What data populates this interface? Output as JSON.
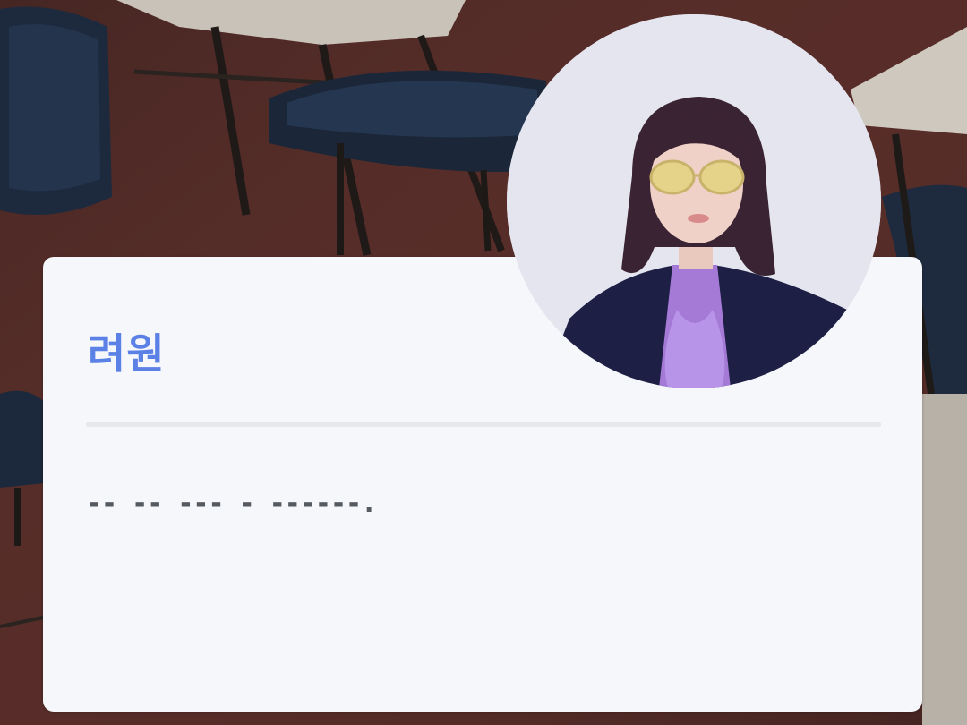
{
  "profile": {
    "name": "려원",
    "message": "-- -- --- - ------."
  },
  "avatar": {
    "icon": "profile-photo"
  },
  "colors": {
    "name": "#5b80e6",
    "card": "#f5f7fa",
    "message": "#555a60"
  }
}
